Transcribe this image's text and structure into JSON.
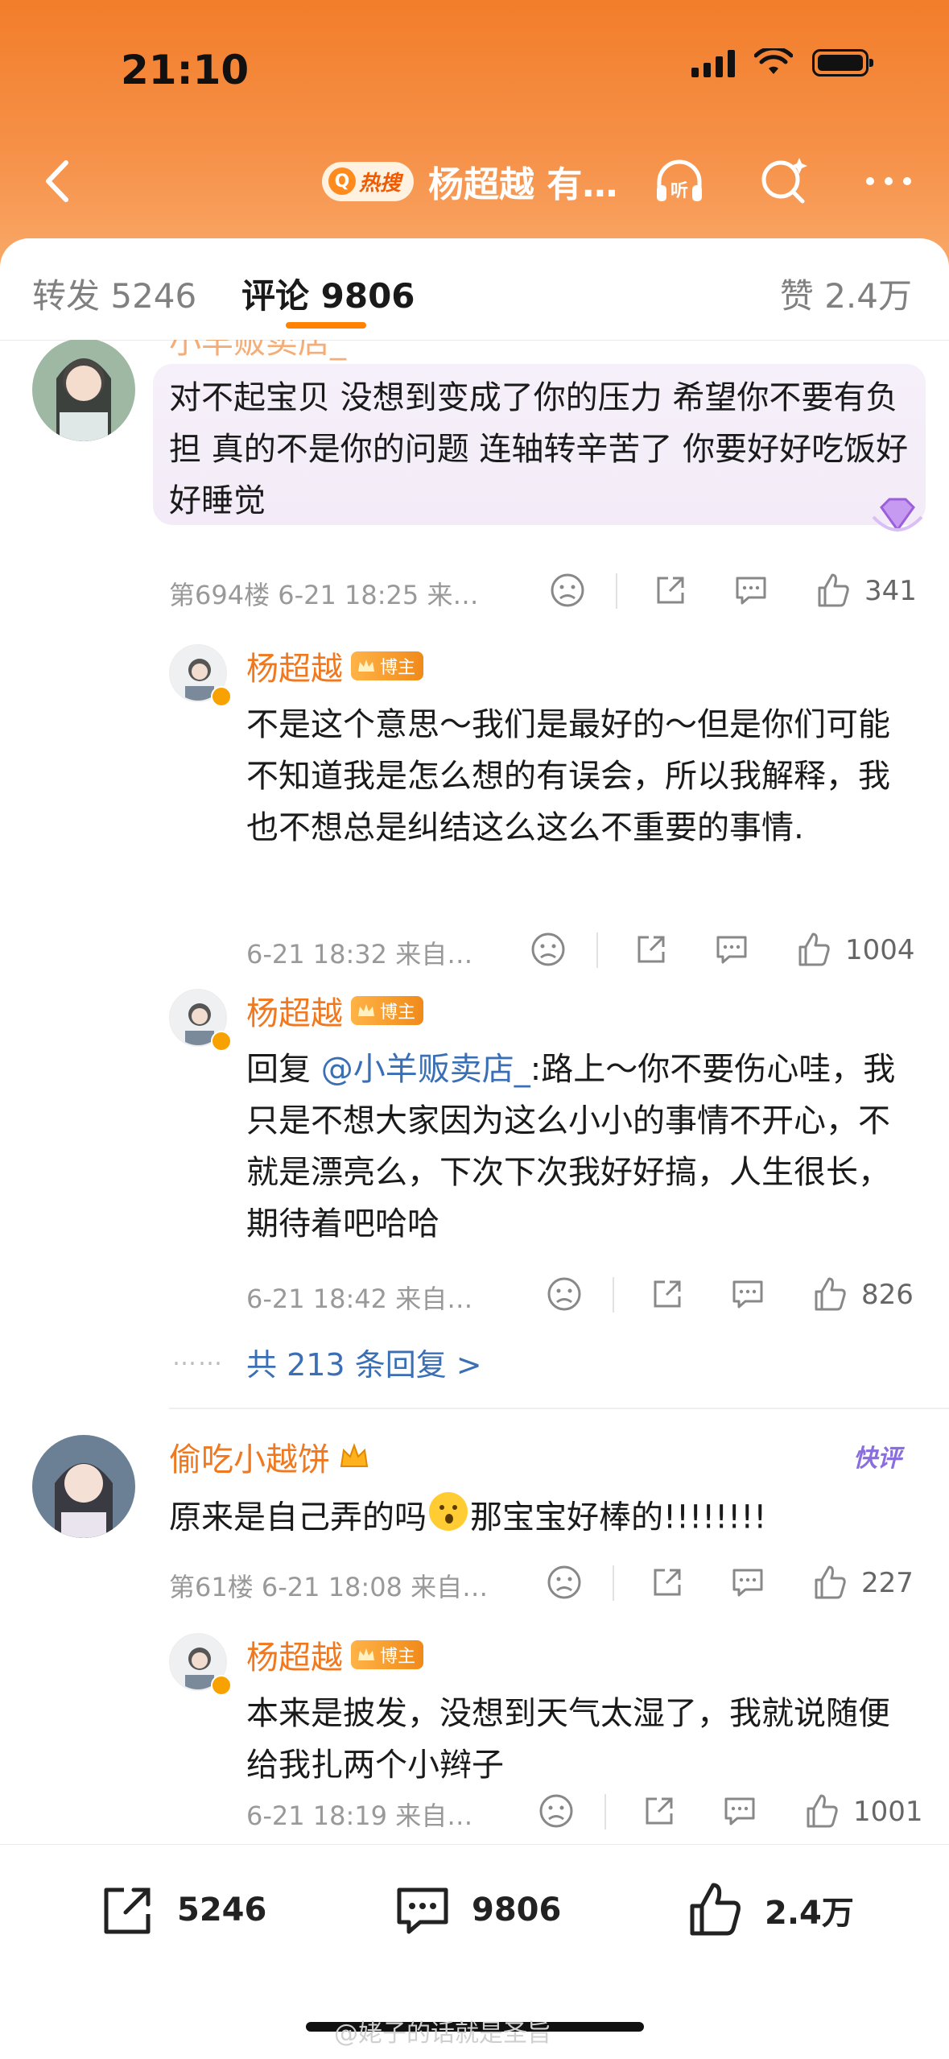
{
  "status_bar": {
    "time": "21:10"
  },
  "nav": {
    "hot_label": "热搜",
    "title": "杨超越 有…",
    "listen_label": "听"
  },
  "tabs": {
    "repost": "转发 5246",
    "comment": "评论 9806",
    "likes": "赞 2.4万"
  },
  "colors": {
    "accent": "#ff8200",
    "username": "#f0781e",
    "link": "#3a6fb5"
  },
  "comments": [
    {
      "username": "小羊贩卖店_",
      "text": "对不起宝贝 没想到变成了你的压力 希望你不要有负担 真的不是你的问题 连轴转辛苦了 你要好好吃饭好好睡觉",
      "meta": "第694楼 6-21 18:25 来…",
      "likes": "341",
      "replies": [
        {
          "username": "杨超越",
          "badge": "博主",
          "text": "不是这个意思～我们是最好的～但是你们可能不知道我是怎么想的有误会，所以我解释，我也不想总是纠结这么这么不重要的事情.",
          "meta": "6-21 18:32 来自…",
          "likes": "1004"
        },
        {
          "username": "杨超越",
          "badge": "博主",
          "reply_prefix": "回复 ",
          "mention": "@小羊贩卖店_",
          "text": ":路上～你不要伤心哇，我只是不想大家因为这么小小的事情不开心，不就是漂亮么，下次下次我好好搞，人生很长，期待着吧哈哈",
          "meta": "6-21 18:42 来自…",
          "likes": "826"
        }
      ],
      "more_replies": "共 213 条回复 >"
    },
    {
      "username": "偷吃小越饼",
      "tag": "快评",
      "text_before": "原来是自己弄的吗",
      "text_after": "那宝宝好棒的!!!!!!!!",
      "meta": "第61楼 6-21 18:08 来自…",
      "likes": "227",
      "replies": [
        {
          "username": "杨超越",
          "badge": "博主",
          "text": "本来是披发，没想到天气太湿了，我就说随便给我扎两个小辫子",
          "meta": "6-21 18:19 来自…",
          "likes": "1001"
        }
      ]
    }
  ],
  "bottom_bar": {
    "repost": "5246",
    "comment": "9806",
    "like": "2.4万"
  },
  "watermark": "@姥子的话就是圣旨"
}
